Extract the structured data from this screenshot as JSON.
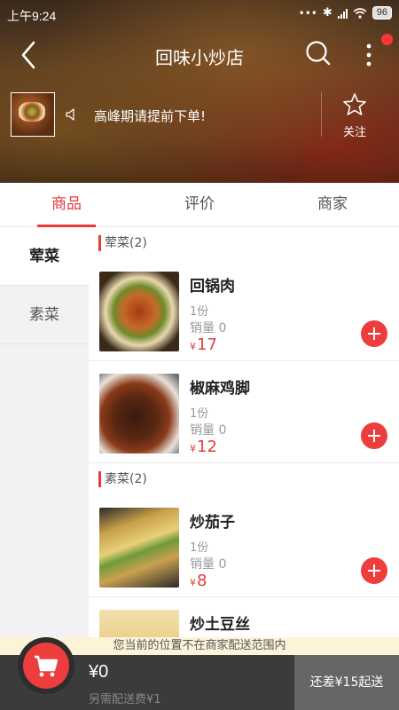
{
  "status": {
    "time": "上午9:24",
    "battery": "96"
  },
  "header": {
    "title": "回味小炒店",
    "notice": "高峰期请提前下单!",
    "follow_label": "关注"
  },
  "tabs": [
    "商品",
    "评价",
    "商家"
  ],
  "sidebar": {
    "categories": [
      "荤菜",
      "素菜"
    ]
  },
  "sections": [
    {
      "title": "荤菜(2)",
      "items": [
        {
          "name": "回锅肉",
          "unit": "1份",
          "sales": "销量 0",
          "currency": "¥",
          "price": "17"
        },
        {
          "name": "椒麻鸡脚",
          "unit": "1份",
          "sales": "销量 0",
          "currency": "¥",
          "price": "12"
        }
      ]
    },
    {
      "title": "素菜(2)",
      "items": [
        {
          "name": "炒茄子",
          "unit": "1份",
          "sales": "销量 0",
          "currency": "¥",
          "price": "8"
        },
        {
          "name": "炒土豆丝"
        }
      ]
    }
  ],
  "warning": "您当前的位置不在商家配送范围内",
  "cart": {
    "total": "¥0",
    "delivery_fee": "另需配送费¥1",
    "checkout_label": "还差¥15起送"
  },
  "colors": {
    "accent": "#e83a3a",
    "cart_bar": "#3b3b3b"
  }
}
